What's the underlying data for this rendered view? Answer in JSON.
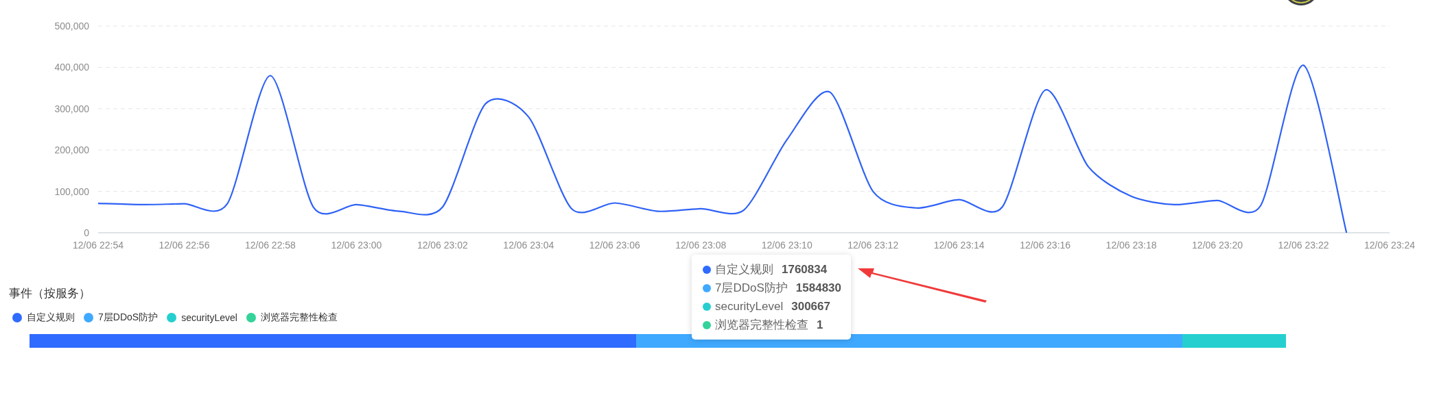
{
  "traffic_chart": {
    "chart_data": {
      "type": "line",
      "categories": [
        "12/06 22:54",
        null,
        "12/06 22:56",
        null,
        "12/06 22:58",
        null,
        "12/06 23:00",
        null,
        "12/06 23:02",
        null,
        "12/06 23:04",
        null,
        "12/06 23:06",
        null,
        "12/06 23:08",
        null,
        "12/06 23:10",
        null,
        "12/06 23:12",
        null,
        "12/06 23:14",
        null,
        "12/06 23:16",
        null,
        "12/06 23:18",
        null,
        "12/06 23:20",
        null,
        "12/06 23:22",
        null,
        "12/06 23:24"
      ],
      "grid": true,
      "series": [
        {
          "color": "#2f62f5",
          "values": [
            71000,
            68000,
            70000,
            70000,
            380000,
            62000,
            68000,
            52000,
            62000,
            312000,
            280000,
            58000,
            72000,
            52000,
            58000,
            55000,
            225000,
            340000,
            100000,
            60000,
            80000,
            62000,
            345000,
            160000,
            88000,
            68000,
            78000,
            65000,
            405000,
            0,
            null
          ]
        }
      ],
      "ylim": [
        0,
        500000
      ],
      "yticks": [
        {
          "value": 0,
          "label": "0"
        },
        {
          "value": 100000,
          "label": "100,000"
        },
        {
          "value": 200000,
          "label": "200,000"
        },
        {
          "value": 300000,
          "label": "300,000"
        },
        {
          "value": 400000,
          "label": "400,000"
        },
        {
          "value": 500000,
          "label": "500,000"
        }
      ]
    }
  },
  "tooltip": {
    "items": [
      {
        "label": "自定义规则",
        "value": "1760834",
        "color": "#2f6bff"
      },
      {
        "label": "7层DDoS防护",
        "value": "1584830",
        "color": "#3fa9ff"
      },
      {
        "label": "securityLevel",
        "value": "300667",
        "color": "#26cfcf"
      },
      {
        "label": "浏览器完整性检查",
        "value": "1",
        "color": "#34d399"
      }
    ]
  },
  "events": {
    "title": "事件（按服务）",
    "legend": [
      {
        "label": "自定义规则",
        "color": "#2f6bff"
      },
      {
        "label": "7层DDoS防护",
        "color": "#3fa9ff"
      },
      {
        "label": "securityLevel",
        "color": "#26cfcf"
      },
      {
        "label": "浏览器完整性检查",
        "color": "#34d399"
      }
    ]
  }
}
